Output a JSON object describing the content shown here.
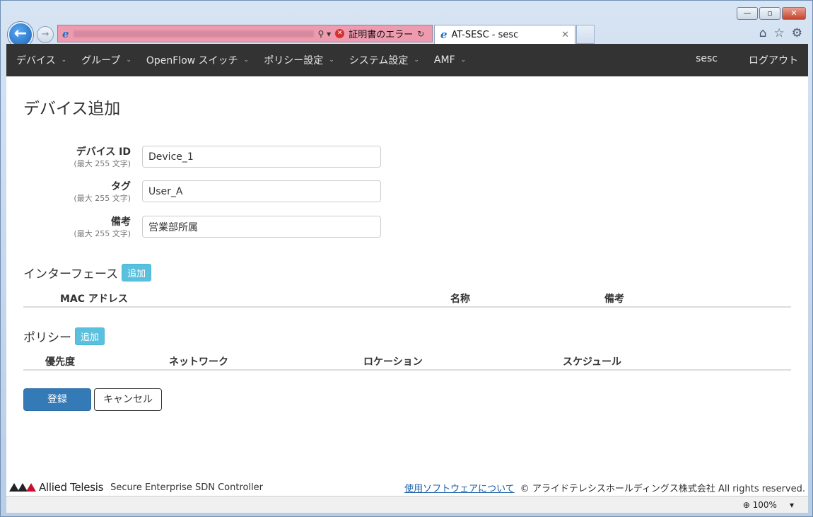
{
  "browser": {
    "address_error": "証明書のエラー",
    "tab_title": "AT-SESC - sesc",
    "zoom": "100%"
  },
  "nav": {
    "items": [
      {
        "label": "デバイス"
      },
      {
        "label": "グループ"
      },
      {
        "label": "OpenFlow スイッチ"
      },
      {
        "label": "ポリシー設定"
      },
      {
        "label": "システム設定"
      },
      {
        "label": "AMF"
      }
    ],
    "user": "sesc",
    "logout": "ログアウト"
  },
  "page": {
    "title": "デバイス追加"
  },
  "form": {
    "device_id": {
      "label": "デバイス ID",
      "hint": "(最大 255 文字)",
      "value": "Device_1"
    },
    "tag": {
      "label": "タグ",
      "hint": "(最大 255 文字)",
      "value": "User_A"
    },
    "note": {
      "label": "備考",
      "hint": "(最大 255 文字)",
      "value": "営業部所属"
    }
  },
  "interfaces": {
    "title": "インターフェース",
    "add_label": "追加",
    "columns": [
      "MAC アドレス",
      "名称",
      "備考"
    ]
  },
  "policies": {
    "title": "ポリシー",
    "add_label": "追加",
    "columns": [
      "優先度",
      "ネットワーク",
      "ロケーション",
      "スケジュール"
    ]
  },
  "actions": {
    "register": "登録",
    "cancel": "キャンセル"
  },
  "footer": {
    "brand": "Allied Telesis",
    "product": "Secure Enterprise SDN Controller",
    "software_link": "使用ソフトウェアについて",
    "copyright": "© アライドテレシスホールディングス株式会社 All rights reserved."
  }
}
